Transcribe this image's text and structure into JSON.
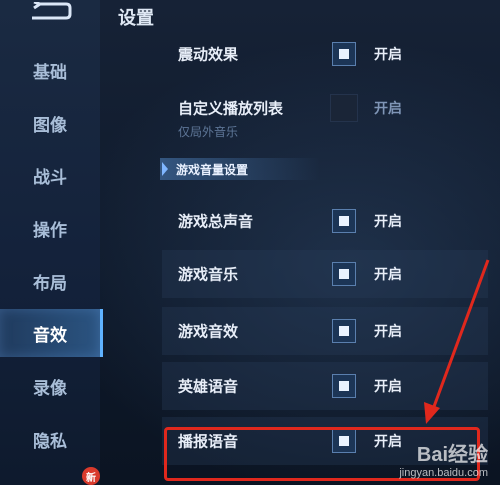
{
  "page_title": "设置",
  "sidebar": {
    "items": [
      {
        "label": "基础"
      },
      {
        "label": "图像"
      },
      {
        "label": "战斗"
      },
      {
        "label": "操作"
      },
      {
        "label": "布局"
      },
      {
        "label": "音效",
        "active": true
      },
      {
        "label": "录像"
      },
      {
        "label": "隐私"
      }
    ],
    "new_badge": "新"
  },
  "settings": {
    "vibration": {
      "label": "震动效果",
      "state": "开启",
      "checked": true
    },
    "playlist": {
      "label": "自定义播放列表",
      "state": "开启",
      "checked": false,
      "sub": "仅局外音乐"
    },
    "section": "游戏音量设置",
    "rows": [
      {
        "label": "游戏总声音",
        "state": "开启",
        "checked": true
      },
      {
        "label": "游戏音乐",
        "state": "开启",
        "checked": true
      },
      {
        "label": "游戏音效",
        "state": "开启",
        "checked": true
      },
      {
        "label": "英雄语音",
        "state": "开启",
        "checked": true
      },
      {
        "label": "播报语音",
        "state": "开启",
        "checked": true
      }
    ]
  },
  "watermark": {
    "brand": "Bai经验",
    "url": "jingyan.baidu.com"
  },
  "colors": {
    "accent": "#5fb2ff",
    "highlight": "#e0281d"
  }
}
